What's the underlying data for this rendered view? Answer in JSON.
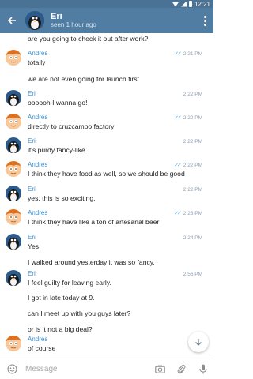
{
  "status_bar": {
    "time": "12:21"
  },
  "header": {
    "name": "Eri",
    "status": "seen 1 hour ago"
  },
  "messages": [
    {
      "sender": "",
      "text": "are you going to check it out after work?",
      "time": ""
    },
    {
      "sender": "Andrés",
      "text": "totally",
      "time": "2:21 PM",
      "read": true
    },
    {
      "sender": "",
      "text": "we are not even going for launch first",
      "time": ""
    },
    {
      "sender": "Eri",
      "text": "oooooh I wanna go!",
      "time": "2:22 PM"
    },
    {
      "sender": "Andrés",
      "text": "directly to cruzcampo factory",
      "time": "2:22 PM",
      "read": true
    },
    {
      "sender": "Eri",
      "text": "it's purdy fancy-like",
      "time": "2:22 PM"
    },
    {
      "sender": "Andrés",
      "text": "I think they have food as well, so we should be good",
      "time": "2:22 PM",
      "read": true
    },
    {
      "sender": "Eri",
      "text": "yes. this is so exciting.",
      "time": "2:22 PM"
    },
    {
      "sender": "Andrés",
      "text": "I think they have like a ton of artesanal beer",
      "time": "2:23 PM",
      "read": true
    },
    {
      "sender": "Eri",
      "text": "Yes",
      "time": "2:24 PM"
    },
    {
      "sender": "",
      "text": "I walked around yesterday it was so fancy.",
      "time": ""
    },
    {
      "sender": "Eri",
      "text": "I feel guilty for leaving early.",
      "time": "2:56 PM"
    },
    {
      "sender": "",
      "text": "I got in late today at 9.",
      "time": ""
    },
    {
      "sender": "",
      "text": "can I meet up with you guys later?",
      "time": ""
    },
    {
      "sender": "",
      "text": "or is it not a big deal?",
      "time": ""
    },
    {
      "sender": "Andrés",
      "text": "of course",
      "time": ""
    }
  ],
  "input": {
    "placeholder": "Message"
  },
  "colors": {
    "header": "#517da2",
    "status_bar": "#4a7294",
    "sender_name": "#3a8fd1",
    "read_check": "#53a7e0"
  }
}
